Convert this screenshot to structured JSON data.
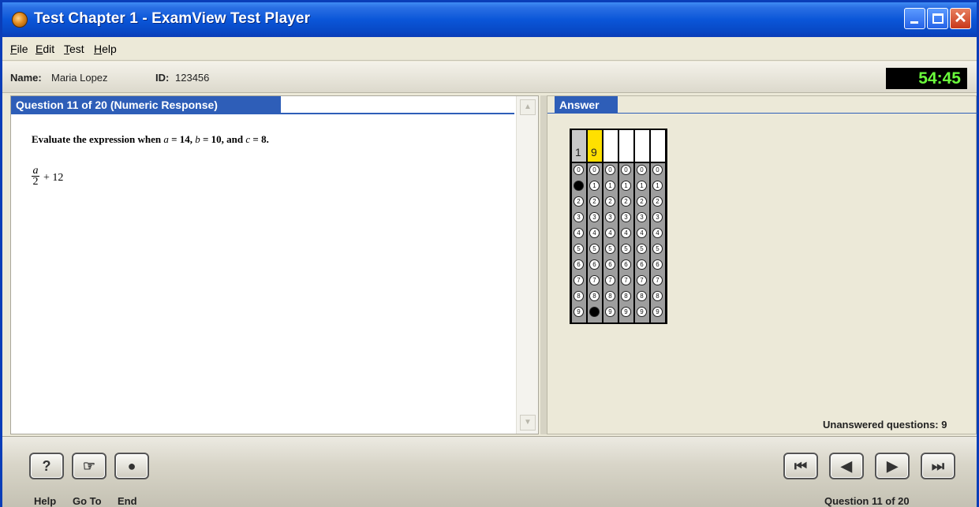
{
  "window": {
    "title": "Test Chapter 1 - ExamView Test Player",
    "icons": {
      "app": "examview-app-icon",
      "minimize": "minimize-icon",
      "maximize": "maximize-icon",
      "close": "close-icon"
    }
  },
  "menu": {
    "items": [
      {
        "label": "File",
        "mnemonic": "F",
        "rest": "ile"
      },
      {
        "label": "Edit",
        "mnemonic": "E",
        "rest": "dit"
      },
      {
        "label": "Test",
        "mnemonic": "T",
        "rest": "est"
      },
      {
        "label": "Help",
        "mnemonic": "H",
        "rest": "elp"
      }
    ]
  },
  "student": {
    "name_label": "Name:",
    "name_value": "Maria Lopez",
    "id_label": "ID:",
    "id_value": "123456"
  },
  "timer": "54:45",
  "question": {
    "header": "Question 11 of 20 (Numeric Response)",
    "prompt_parts": [
      "Evaluate the expression when ",
      "a",
      " = 14, ",
      "b",
      " = 10, and ",
      "c",
      " = 8."
    ],
    "expression": {
      "numerator": "a",
      "denominator": "2",
      "rest": "+ 12"
    }
  },
  "answer": {
    "header": "Answer",
    "entered_digits": [
      "1",
      "9",
      "",
      "",
      "",
      ""
    ],
    "columns": 6,
    "digits": [
      "0",
      "1",
      "2",
      "3",
      "4",
      "5",
      "6",
      "7",
      "8",
      "9"
    ],
    "selected": [
      1,
      9,
      null,
      null,
      null,
      null
    ],
    "highlight_color": "#FFE000",
    "unanswered": "Unanswered questions: 9"
  },
  "toolbar": {
    "help_label": "Help",
    "goto_label": "Go To",
    "end_label": "End",
    "help_glyph": "?",
    "first_glyph": "⏮",
    "prev_glyph": "◀",
    "next_glyph": "▶",
    "last_glyph": "⏭",
    "position": "Question 11 of 20"
  },
  "colors": {
    "titlebar": "#0A56D8",
    "header_blue": "#2E5EB8",
    "timer_text": "#6BFF3C"
  }
}
